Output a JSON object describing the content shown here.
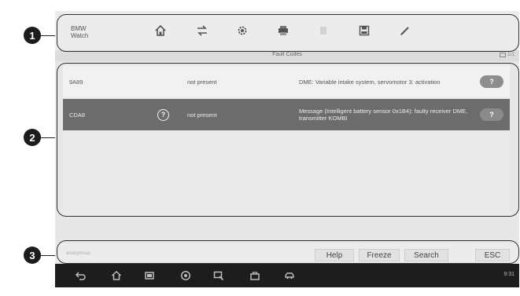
{
  "callouts": [
    "1",
    "2",
    "3"
  ],
  "toolbar": {
    "vehicle_line1": "BMW",
    "vehicle_line2": "Watch",
    "icons": [
      "home-icon",
      "vehicle-swap-icon",
      "settings-icon",
      "print-icon",
      "help-icon",
      "save-icon",
      "pen-icon"
    ]
  },
  "subtitle": {
    "title": "Fault Codes",
    "page": "1/1"
  },
  "codes": [
    {
      "code": "9A89",
      "status": "not present",
      "description": "DME: Variable intake system, servomotor 3: activation",
      "help": "?"
    },
    {
      "code": "CDA8",
      "status": "not present",
      "description": "Message (Intelligent battery sensor 0x1B4): faulty receiver DME, transmitter KOMBI",
      "help": "?",
      "icon": "?"
    }
  ],
  "bottom": {
    "status": "anonymous",
    "help": "Help",
    "freeze": "Freeze",
    "search": "Search",
    "esc": "ESC"
  },
  "navbar": {
    "icons": [
      "back-icon",
      "home-icon",
      "recent-apps-icon",
      "browser-icon",
      "vci-icon",
      "shop-icon",
      "car-icon"
    ],
    "clock": "9:31"
  },
  "colors": {
    "selected_row": "#6c6c6c",
    "nav_bar": "#1d1d1d",
    "callout": "#1c1c1c"
  }
}
